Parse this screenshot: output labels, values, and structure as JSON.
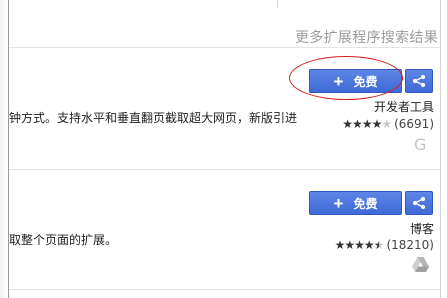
{
  "header": {
    "more_results": "更多扩展程序搜索结果"
  },
  "items": [
    {
      "description": "钟方式。支持水平和垂直翻页截取超大网页，新版引进",
      "install_label": "免费",
      "category": "开发者工具",
      "rating_value": 4,
      "rating_count": "(6691)",
      "developer_badge": "G",
      "badge_icon": "google-g-icon"
    },
    {
      "description": "取整个页面的扩展。",
      "install_label": "免费",
      "category": "博客",
      "rating_value": 4.5,
      "rating_count": "(18210)",
      "badge_icon": "google-drive-icon"
    }
  ],
  "colors": {
    "button": "#4a74de",
    "annotation": "#d61c1c",
    "muted": "#9b9b9b"
  }
}
